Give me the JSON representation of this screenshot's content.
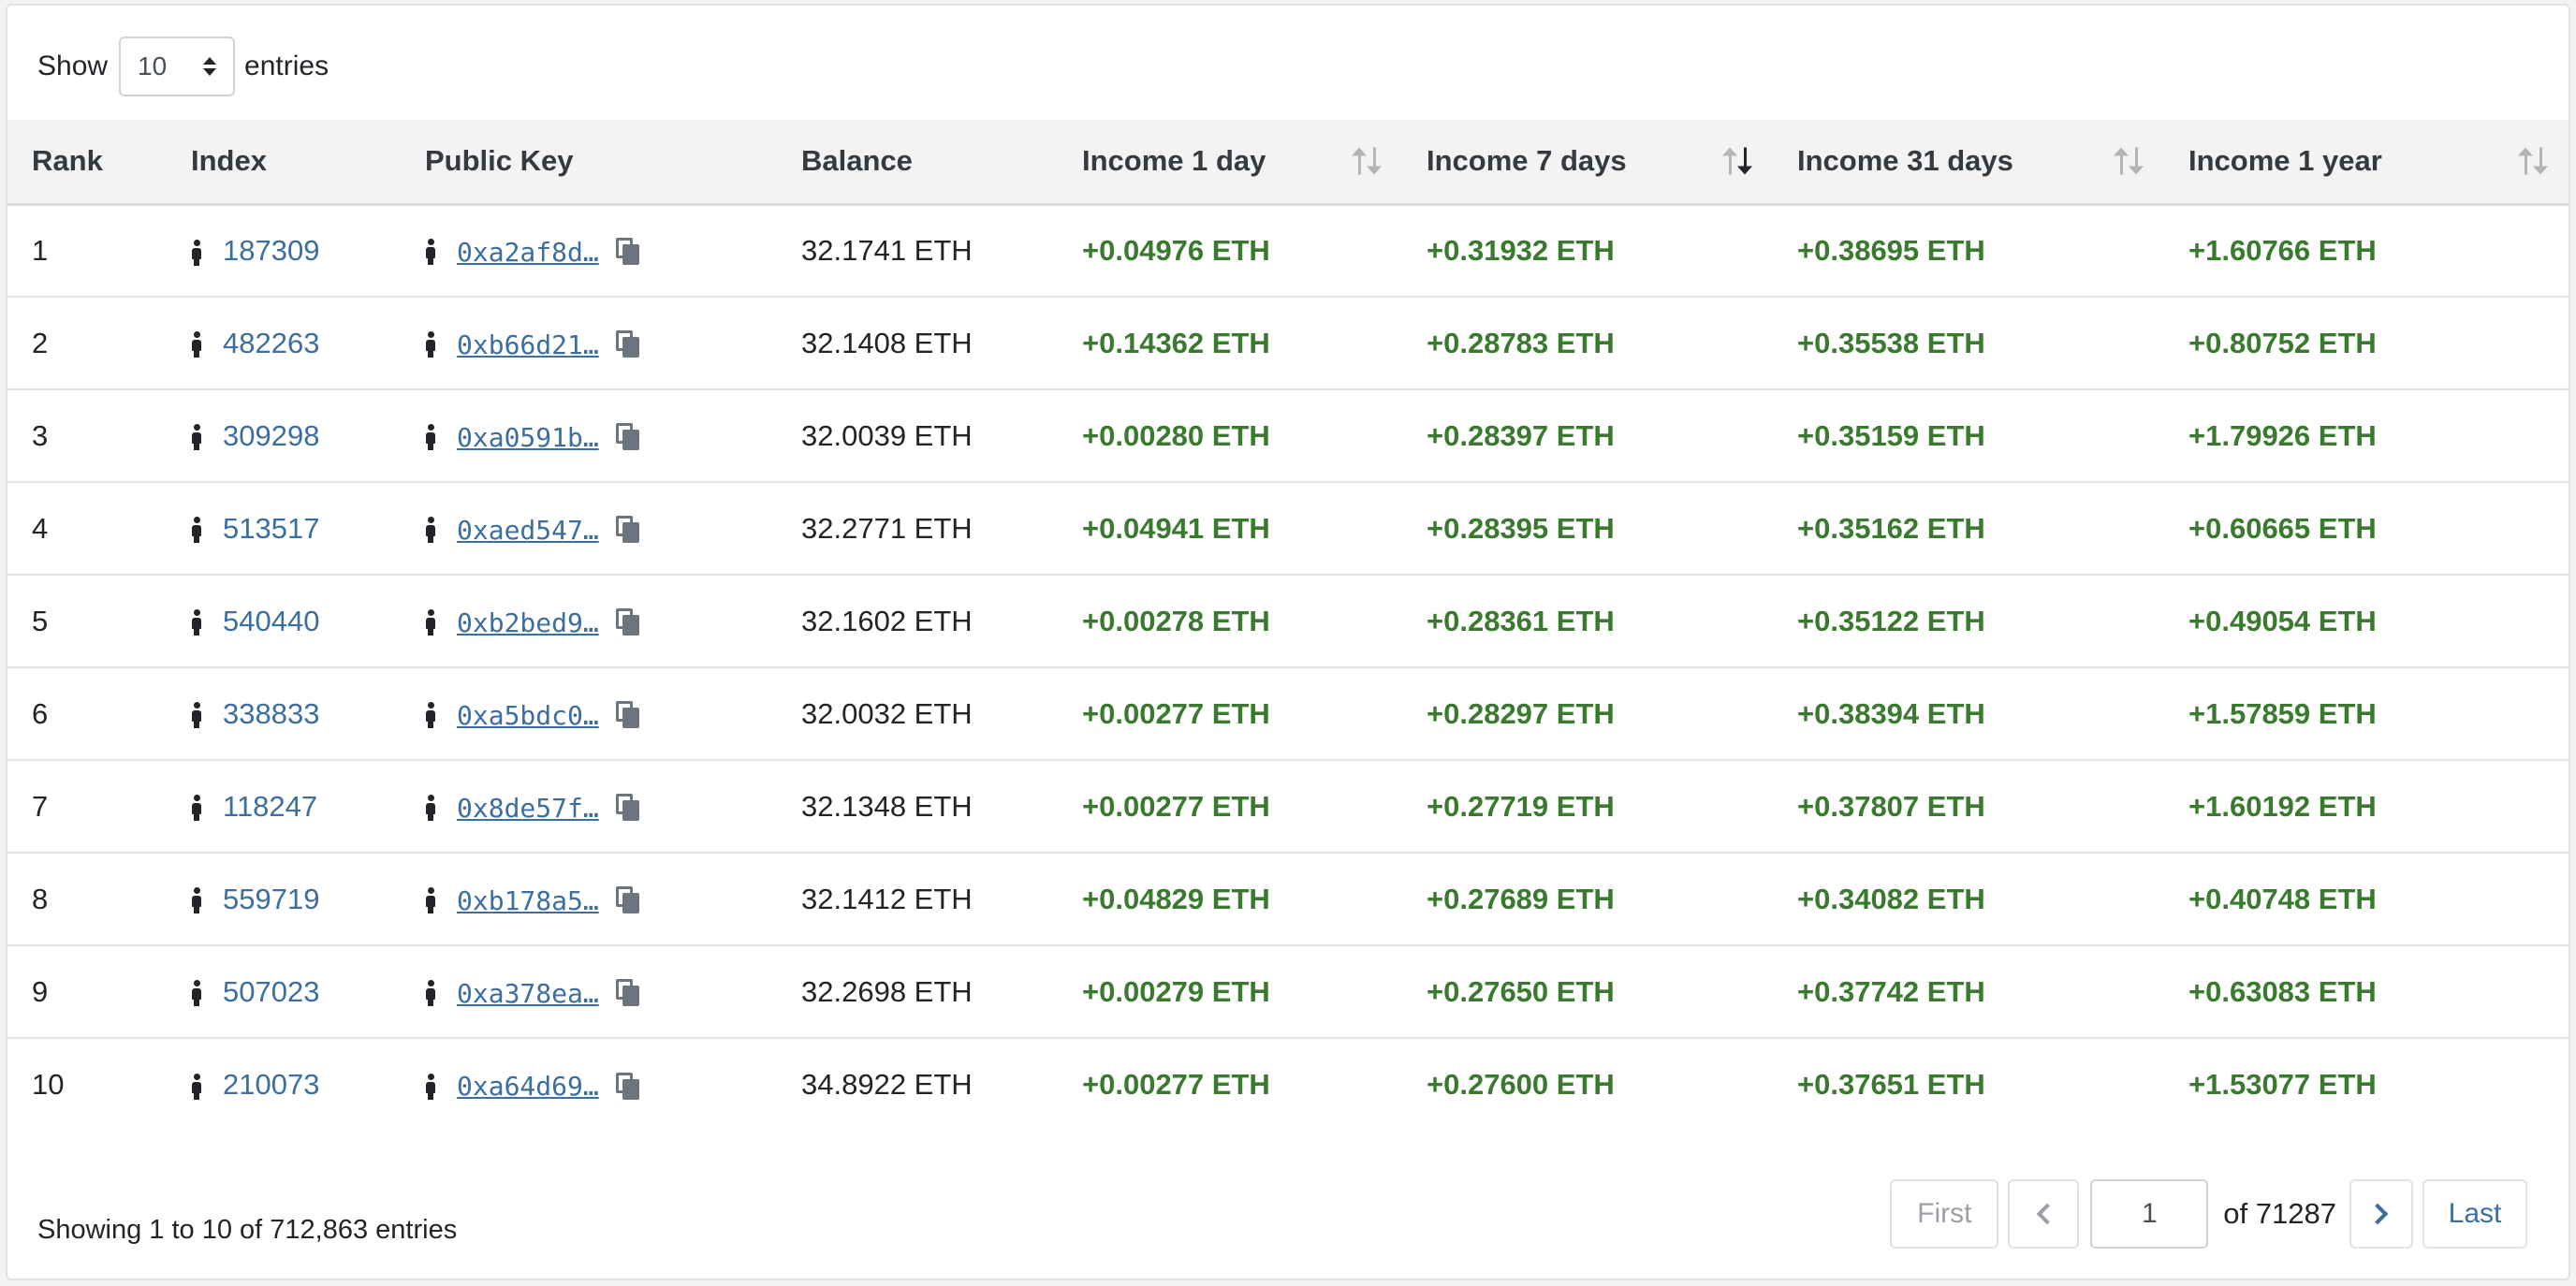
{
  "length_menu": {
    "prefix": "Show",
    "value": "10",
    "suffix": "entries"
  },
  "columns": [
    "Rank",
    "Index",
    "Public Key",
    "Balance",
    "Income 1 day",
    "Income 7 days",
    "Income 31 days",
    "Income 1 year"
  ],
  "rows": [
    {
      "rank": "1",
      "index": "187309",
      "pubkey": "0xa2af8d…",
      "balance": "32.1741 ETH",
      "inc1d": "+0.04976 ETH",
      "inc7d": "+0.31932 ETH",
      "inc31d": "+0.38695 ETH",
      "inc1y": "+1.60766 ETH"
    },
    {
      "rank": "2",
      "index": "482263",
      "pubkey": "0xb66d21…",
      "balance": "32.1408 ETH",
      "inc1d": "+0.14362 ETH",
      "inc7d": "+0.28783 ETH",
      "inc31d": "+0.35538 ETH",
      "inc1y": "+0.80752 ETH"
    },
    {
      "rank": "3",
      "index": "309298",
      "pubkey": "0xa0591b…",
      "balance": "32.0039 ETH",
      "inc1d": "+0.00280 ETH",
      "inc7d": "+0.28397 ETH",
      "inc31d": "+0.35159 ETH",
      "inc1y": "+1.79926 ETH"
    },
    {
      "rank": "4",
      "index": "513517",
      "pubkey": "0xaed547…",
      "balance": "32.2771 ETH",
      "inc1d": "+0.04941 ETH",
      "inc7d": "+0.28395 ETH",
      "inc31d": "+0.35162 ETH",
      "inc1y": "+0.60665 ETH"
    },
    {
      "rank": "5",
      "index": "540440",
      "pubkey": "0xb2bed9…",
      "balance": "32.1602 ETH",
      "inc1d": "+0.00278 ETH",
      "inc7d": "+0.28361 ETH",
      "inc31d": "+0.35122 ETH",
      "inc1y": "+0.49054 ETH"
    },
    {
      "rank": "6",
      "index": "338833",
      "pubkey": "0xa5bdc0…",
      "balance": "32.0032 ETH",
      "inc1d": "+0.00277 ETH",
      "inc7d": "+0.28297 ETH",
      "inc31d": "+0.38394 ETH",
      "inc1y": "+1.57859 ETH"
    },
    {
      "rank": "7",
      "index": "118247",
      "pubkey": "0x8de57f…",
      "balance": "32.1348 ETH",
      "inc1d": "+0.00277 ETH",
      "inc7d": "+0.27719 ETH",
      "inc31d": "+0.37807 ETH",
      "inc1y": "+1.60192 ETH"
    },
    {
      "rank": "8",
      "index": "559719",
      "pubkey": "0xb178a5…",
      "balance": "32.1412 ETH",
      "inc1d": "+0.04829 ETH",
      "inc7d": "+0.27689 ETH",
      "inc31d": "+0.34082 ETH",
      "inc1y": "+0.40748 ETH"
    },
    {
      "rank": "9",
      "index": "507023",
      "pubkey": "0xa378ea…",
      "balance": "32.2698 ETH",
      "inc1d": "+0.00279 ETH",
      "inc7d": "+0.27650 ETH",
      "inc31d": "+0.37742 ETH",
      "inc1y": "+0.63083 ETH"
    },
    {
      "rank": "10",
      "index": "210073",
      "pubkey": "0xa64d69…",
      "balance": "34.8922 ETH",
      "inc1d": "+0.00277 ETH",
      "inc7d": "+0.27600 ETH",
      "inc31d": "+0.37651 ETH",
      "inc1y": "+1.53077 ETH"
    }
  ],
  "info": "Showing 1 to 10 of 712,863 entries",
  "pagination": {
    "first": "First",
    "page": "1",
    "of": "of",
    "total_pages": "71287",
    "last": "Last"
  },
  "icons": {
    "validator": "person-icon",
    "copy": "copy-icon",
    "sort": "sort-arrows-icon",
    "select": "select-arrows-icon"
  },
  "colors": {
    "income": "#3a7a2f",
    "link": "#3c6ea0",
    "header_bg": "#f3f3f3"
  }
}
